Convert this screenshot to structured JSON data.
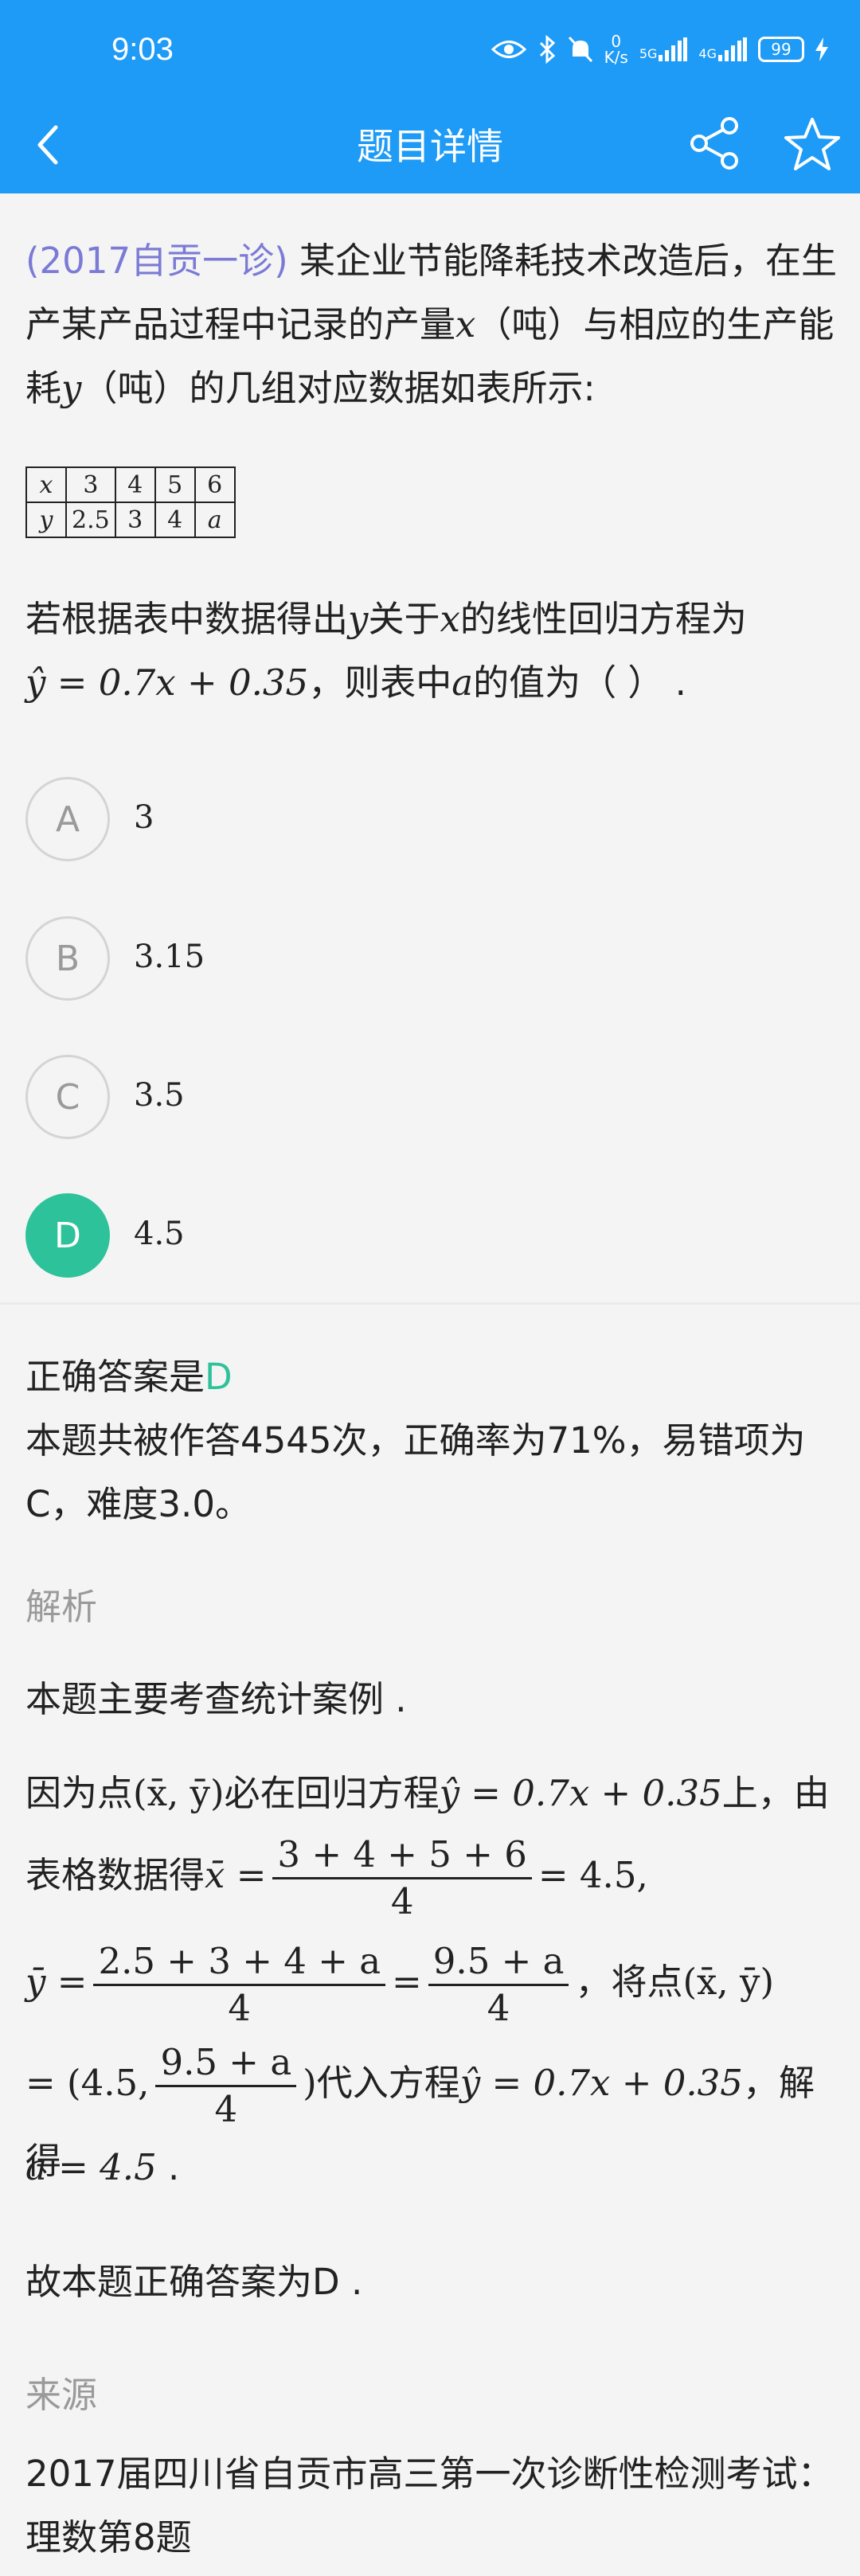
{
  "status_bar": {
    "time": "9:03",
    "net_speed_top": "0",
    "net_speed_unit": "K/s",
    "sig1": "5G",
    "sig2": "4G",
    "battery": "99"
  },
  "nav": {
    "title": "题目详情"
  },
  "question": {
    "source_tag": "(2017自贡一诊)",
    "text_1": " 某企业节能降耗技术改造后，在生产某产品过程中记录的产量",
    "var_x": "x",
    "text_2": "（吨）与相应的生产能耗",
    "var_y": "y",
    "text_3": "（吨）的几组对应数据如表所示:",
    "table": {
      "row_x": [
        "x",
        "3",
        "4",
        "5",
        "6"
      ],
      "row_y": [
        "y",
        "2.5",
        "3",
        "4",
        "a"
      ]
    },
    "q2_a": "若根据表中数据得出",
    "q2_y": "y",
    "q2_b": "关于",
    "q2_x": "x",
    "q2_c": "的线性回归方程为",
    "q2_eq": "ŷ = 0.7x + 0.35",
    "q2_d": "，则表中",
    "q2_a_var": "a",
    "q2_e": "的值为（  ）  ."
  },
  "options": [
    {
      "letter": "A",
      "value": "3"
    },
    {
      "letter": "B",
      "value": "3.15"
    },
    {
      "letter": "C",
      "value": "3.5"
    },
    {
      "letter": "D",
      "value": "4.5"
    }
  ],
  "answer": {
    "label": "正确答案是",
    "letter": "D",
    "stats": "本题共被作答4545次，正确率为71%，易错项为C，难度3.0。"
  },
  "analysis": {
    "title": "解析",
    "intro": "本题主要考查统计案例 .",
    "l1_a": "因为点",
    "l1_pt": "(x̄, ȳ)",
    "l1_b": "必在回归方程",
    "l1_eq": "ŷ = 0.7x + 0.35",
    "l1_c": "上，由",
    "l2_a": "表格数据得",
    "l2_xbar": "x̄ =",
    "l2_num": "3 + 4 + 5 + 6",
    "l2_den": "4",
    "l2_res": "= 4.5,",
    "l3_ybar": "ȳ =",
    "l3_num1": "2.5 + 3 + 4 + a",
    "l3_den1": "4",
    "l3_eq": "=",
    "l3_num2": "9.5 + a",
    "l3_den2": "4",
    "l3_b": "，将点",
    "l3_pt": "(x̄, ȳ)",
    "l4_a": "= (4.5,",
    "l4_num": "9.5 + a",
    "l4_den": "4",
    "l4_b": ")",
    "l4_c": "代入方程",
    "l4_eq": "ŷ = 0.7x + 0.35",
    "l4_d": "，解得",
    "l5": "a = 4.5",
    "l5_tail": " .",
    "conclusion": "故本题正确答案为D ."
  },
  "source": {
    "title": "来源",
    "text": "2017届四川省自贡市高三第一次诊断性检测考试：理数第8题"
  }
}
